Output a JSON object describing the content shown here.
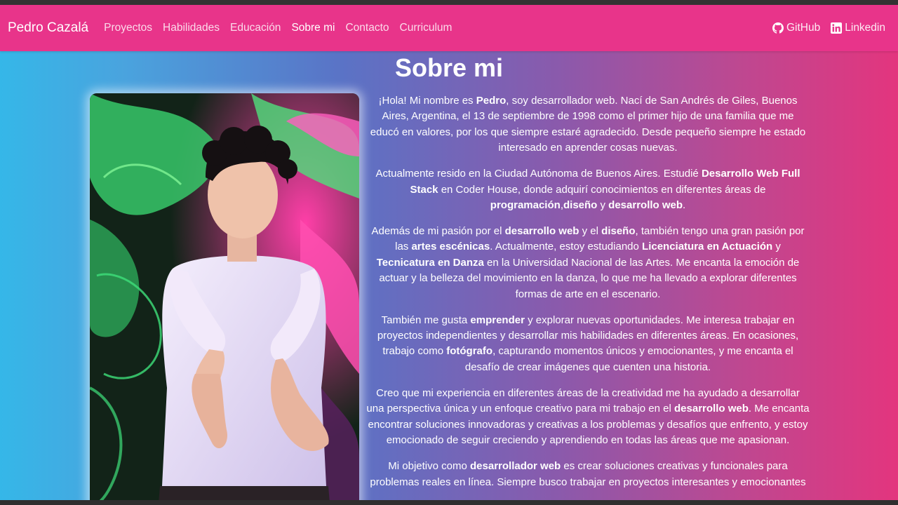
{
  "nav": {
    "brand": "Pedro Cazalá",
    "links": [
      "Proyectos",
      "Habilidades",
      "Educación",
      "Sobre mi",
      "Contacto",
      "Curriculum"
    ],
    "github": "GitHub",
    "linkedin": "Linkedin",
    "active_link": "Sobre mi"
  },
  "page_title": "Sobre mi",
  "icons": {
    "github": "github-icon",
    "linkedin": "linkedin-icon"
  },
  "colors": {
    "navbar": "#e8348a",
    "gradient_left": "#35b7e8",
    "gradient_right": "#e3357e"
  },
  "bio": {
    "p1": [
      {
        "t": "¡Hola! Mi nombre es "
      },
      {
        "t": "Pedro",
        "b": true
      },
      {
        "t": ", soy desarrollador web. Nací de San Andrés de Giles, Buenos Aires, Argentina, el 13 de septiembre de 1998 como el primer hijo de una familia que me educó en valores, por los que siempre estaré agradecido. Desde pequeño siempre he estado interesado en aprender cosas nuevas."
      }
    ],
    "p2": [
      {
        "t": "Actualmente resido en la Ciudad Autónoma de Buenos Aires. Estudié "
      },
      {
        "t": "Desarrollo Web Full Stack",
        "b": true
      },
      {
        "t": " en Coder House, donde adquirí conocimientos en diferentes áreas de "
      },
      {
        "t": "programación",
        "b": true
      },
      {
        "t": ","
      },
      {
        "t": "diseño",
        "b": true
      },
      {
        "t": " y "
      },
      {
        "t": "desarrollo web",
        "b": true
      },
      {
        "t": "."
      }
    ],
    "p3": [
      {
        "t": "Además de mi pasión por el "
      },
      {
        "t": "desarrollo web",
        "b": true
      },
      {
        "t": " y el "
      },
      {
        "t": "diseño",
        "b": true
      },
      {
        "t": ", también tengo una gran pasión por las "
      },
      {
        "t": "artes escénicas",
        "b": true
      },
      {
        "t": ". Actualmente, estoy estudiando "
      },
      {
        "t": "Licenciatura en Actuación",
        "b": true
      },
      {
        "t": " y "
      },
      {
        "t": "Tecnicatura en Danza",
        "b": true
      },
      {
        "t": " en la Universidad Nacional de las Artes. Me encanta la emoción de actuar y la belleza del movimiento en la danza, lo que me ha llevado a explorar diferentes formas de arte en el escenario."
      }
    ],
    "p4": [
      {
        "t": "También me gusta "
      },
      {
        "t": "emprender",
        "b": true
      },
      {
        "t": " y explorar nuevas oportunidades. Me interesa trabajar en proyectos independientes y desarrollar mis habilidades en diferentes áreas. En ocasiones, trabajo como "
      },
      {
        "t": "fotógrafo",
        "b": true
      },
      {
        "t": ", capturando momentos únicos y emocionantes, y me encanta el desafío de crear imágenes que cuenten una historia."
      }
    ],
    "p5": [
      {
        "t": "Creo que mi experiencia en diferentes áreas de la creatividad me ha ayudado a desarrollar una perspectiva única y un enfoque creativo para mi trabajo en el "
      },
      {
        "t": "desarrollo web",
        "b": true
      },
      {
        "t": ". Me encanta encontrar soluciones innovadoras y creativas a los problemas y desafíos que enfrento, y estoy emocionado de seguir creciendo y aprendiendo en todas las áreas que me apasionan."
      }
    ],
    "p6": [
      {
        "t": "Mi objetivo como "
      },
      {
        "t": "desarrollador web",
        "b": true
      },
      {
        "t": " es crear soluciones creativas y funcionales para problemas reales en línea. Siempre busco trabajar en proyectos interesantes y emocionantes"
      }
    ]
  }
}
